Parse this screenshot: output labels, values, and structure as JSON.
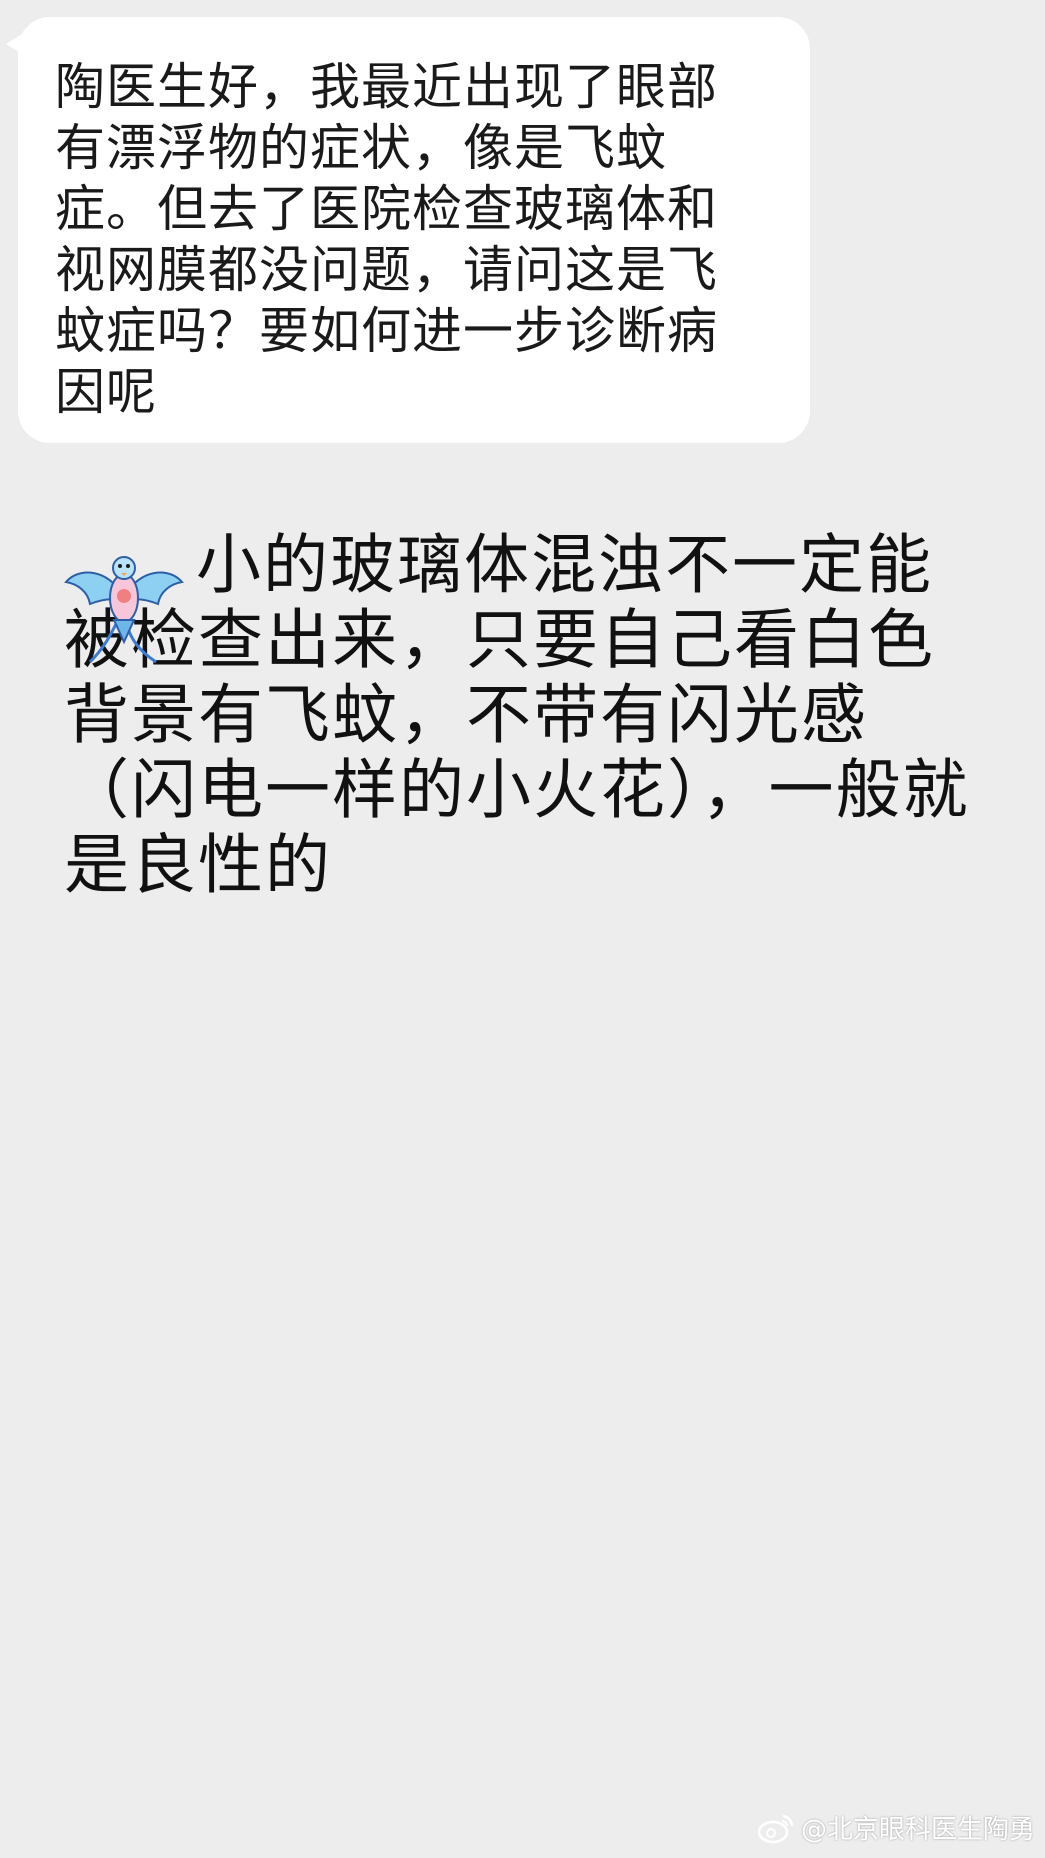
{
  "incoming_message": {
    "text": "陶医生好，我最近出现了眼部有漂浮物的症状，像是飞蚊症。但去了医院检查玻璃体和视网膜都没问题，请问这是飞蚊症吗？要如何进一步诊断病因呢"
  },
  "reply": {
    "emoji_icon": "kite-emoji",
    "text": "小的玻璃体混浊不一定能被检查出来，只要自己看白色背景有飞蚊，不带有闪光感（闪电一样的小火花），一般就是良性的"
  },
  "watermark": {
    "icon": "weibo-logo",
    "text": "@北京眼科医生陶勇"
  },
  "colors": {
    "background": "#ededed",
    "bubble": "#ffffff",
    "text": "#111111"
  }
}
